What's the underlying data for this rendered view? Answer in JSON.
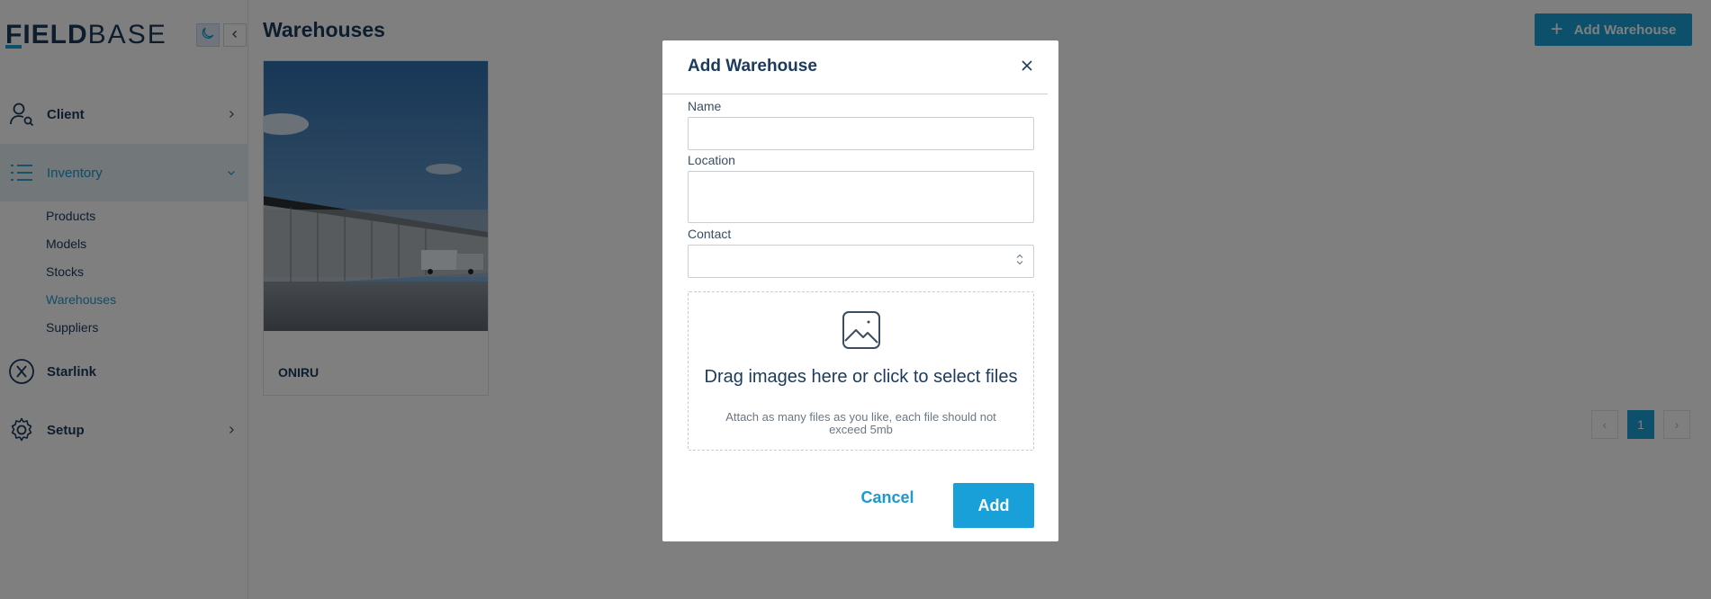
{
  "app": {
    "logo_part1": "FIELD",
    "logo_part2": "BASE"
  },
  "sidebar": {
    "items": [
      {
        "label": "Client",
        "icon": "user-search-icon"
      },
      {
        "label": "Inventory",
        "icon": "list-icon"
      },
      {
        "label": "Starlink",
        "icon": "x-circle-icon"
      },
      {
        "label": "Setup",
        "icon": "gear-icon"
      }
    ],
    "inventory_subitems": [
      "Products",
      "Models",
      "Stocks",
      "Warehouses",
      "Suppliers"
    ],
    "active_subitem": "Warehouses"
  },
  "main": {
    "title": "Warehouses",
    "add_button_label": "Add Warehouse",
    "cards": [
      {
        "name": "ONIRU"
      }
    ],
    "pagination": {
      "current_page": "1",
      "prev": "‹",
      "next": "›"
    }
  },
  "modal": {
    "title": "Add Warehouse",
    "fields": {
      "name_label": "Name",
      "name_value": "",
      "location_label": "Location",
      "location_value": "",
      "contact_label": "Contact",
      "contact_value": ""
    },
    "dropzone": {
      "title": "Drag images here or click to select files",
      "subtitle": "Attach as many files as you like, each file should not exceed 5mb",
      "icon": "image-icon"
    },
    "cancel_label": "Cancel",
    "add_label": "Add"
  },
  "colors": {
    "accent": "#1aa0d8",
    "brand_dark": "#1b3a5c",
    "overlay": "rgba(0,0,0,0.5)"
  }
}
